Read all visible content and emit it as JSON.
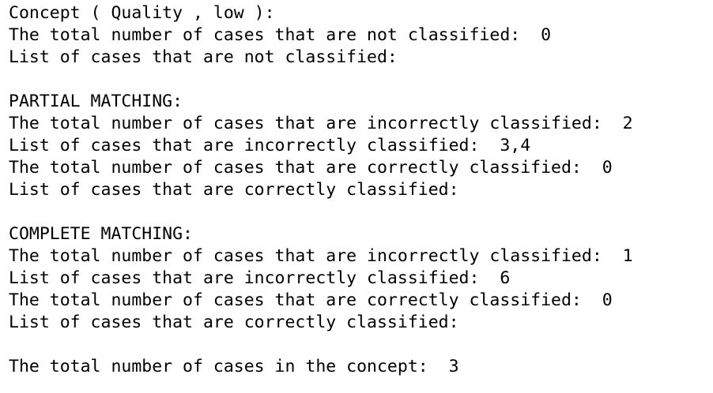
{
  "output": {
    "concept_header": "Concept ( Quality , low ):",
    "not_classified": {
      "total_label": "The total number of cases that are not classified:  0",
      "list_label": "List of cases that are not classified:"
    },
    "partial_matching": {
      "heading": "PARTIAL MATCHING:",
      "incorrect_total": "The total number of cases that are incorrectly classified:  2",
      "incorrect_list": "List of cases that are incorrectly classified:  3,4",
      "correct_total": "The total number of cases that are correctly classified:  0",
      "correct_list": "List of cases that are correctly classified:"
    },
    "complete_matching": {
      "heading": "COMPLETE MATCHING:",
      "incorrect_total": "The total number of cases that are incorrectly classified:  1",
      "incorrect_list": "List of cases that are incorrectly classified:  6",
      "correct_total": "The total number of cases that are correctly classified:  0",
      "correct_list": "List of cases that are correctly classified:"
    },
    "concept_total": "The total number of cases in the concept:  3"
  }
}
